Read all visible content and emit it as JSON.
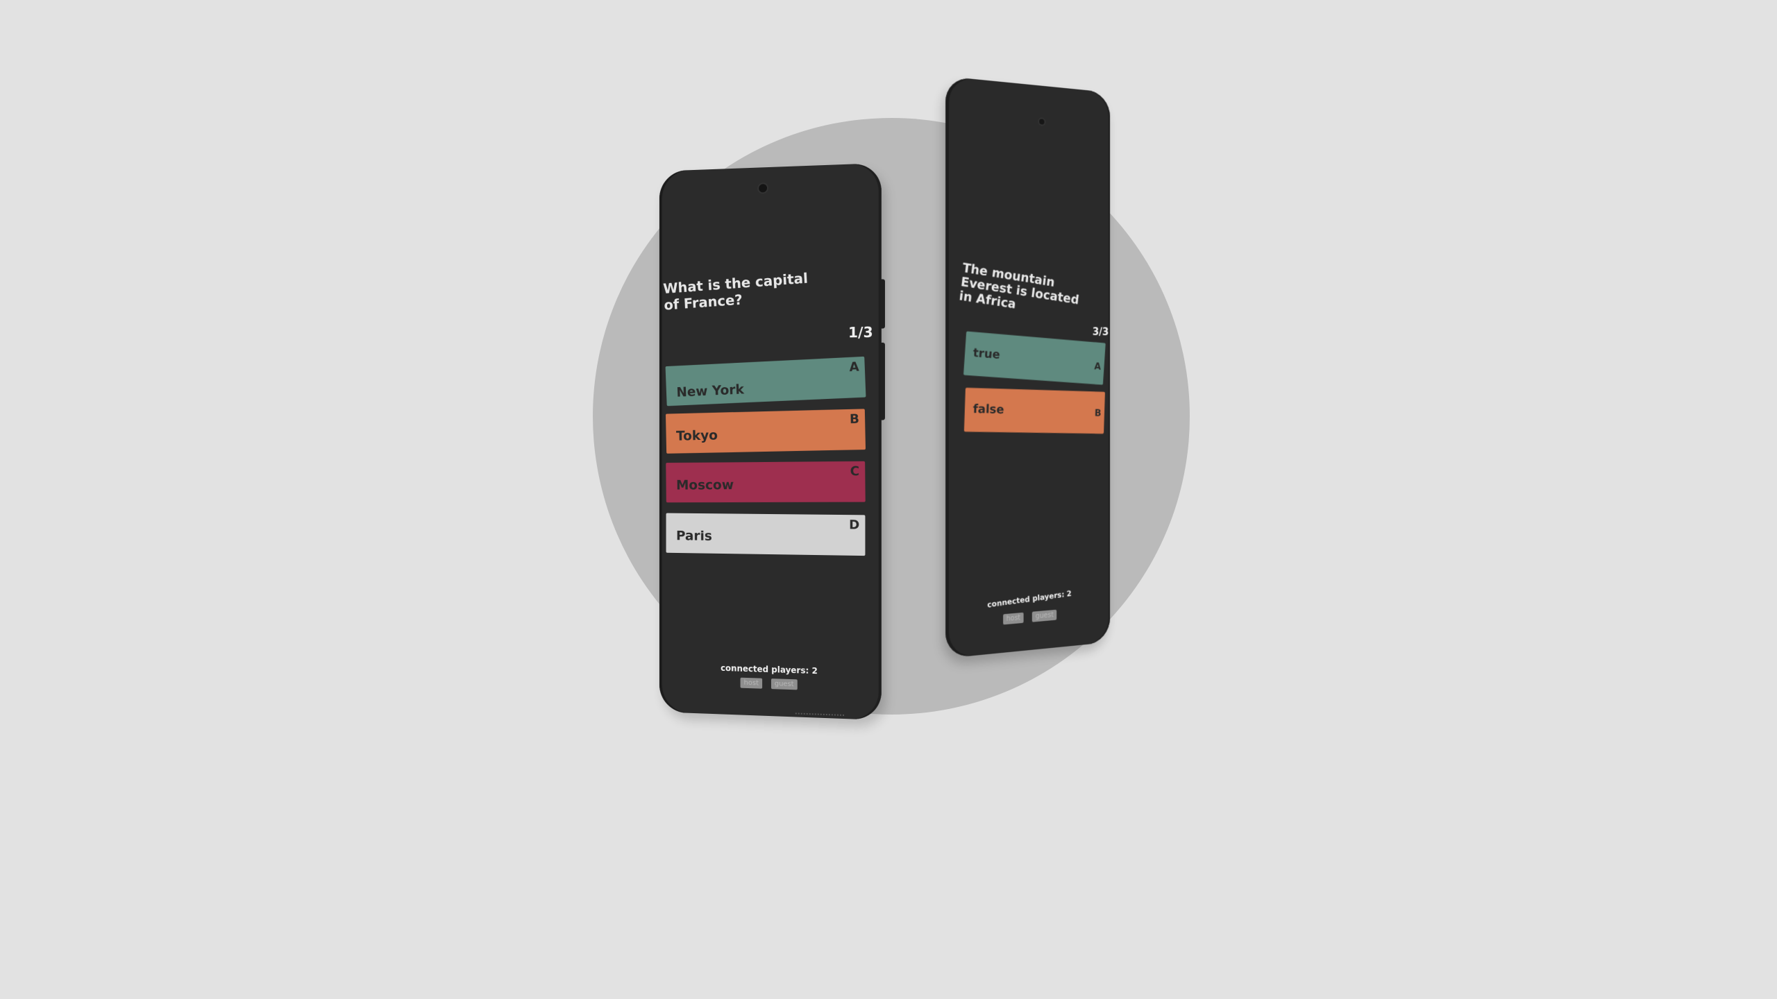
{
  "colors": {
    "background": "#e2e2e2",
    "backdrop_circle": "#bababa",
    "phone_body": "#2b2b2b",
    "teal": "#5f8a7f",
    "orange": "#d4784e",
    "crimson": "#9e2f4f",
    "light_gray": "#d2d2d2",
    "text_light": "#f0f0f0",
    "text_dark": "#2a2a2a"
  },
  "phone_1": {
    "question": "What is the capital of France?",
    "counter": "1/3",
    "answers": [
      {
        "label": "New York",
        "key": "A",
        "color": "#5f8a7f"
      },
      {
        "label": "Tokyo",
        "key": "B",
        "color": "#d4784e"
      },
      {
        "label": "Moscow",
        "key": "C",
        "color": "#9e2f4f"
      },
      {
        "label": "Paris",
        "key": "D",
        "color": "#d2d2d2"
      }
    ],
    "players": "connected players: 2",
    "roles": [
      "host",
      "guest"
    ]
  },
  "phone_2": {
    "question": "The mountain Everest is located in Africa",
    "counter": "3/3",
    "answers": [
      {
        "label": "true",
        "key": "A",
        "color": "#5f8a7f"
      },
      {
        "label": "false",
        "key": "B",
        "color": "#d4784e"
      }
    ],
    "players": "connected players: 2",
    "roles": [
      "host",
      "guest"
    ]
  }
}
